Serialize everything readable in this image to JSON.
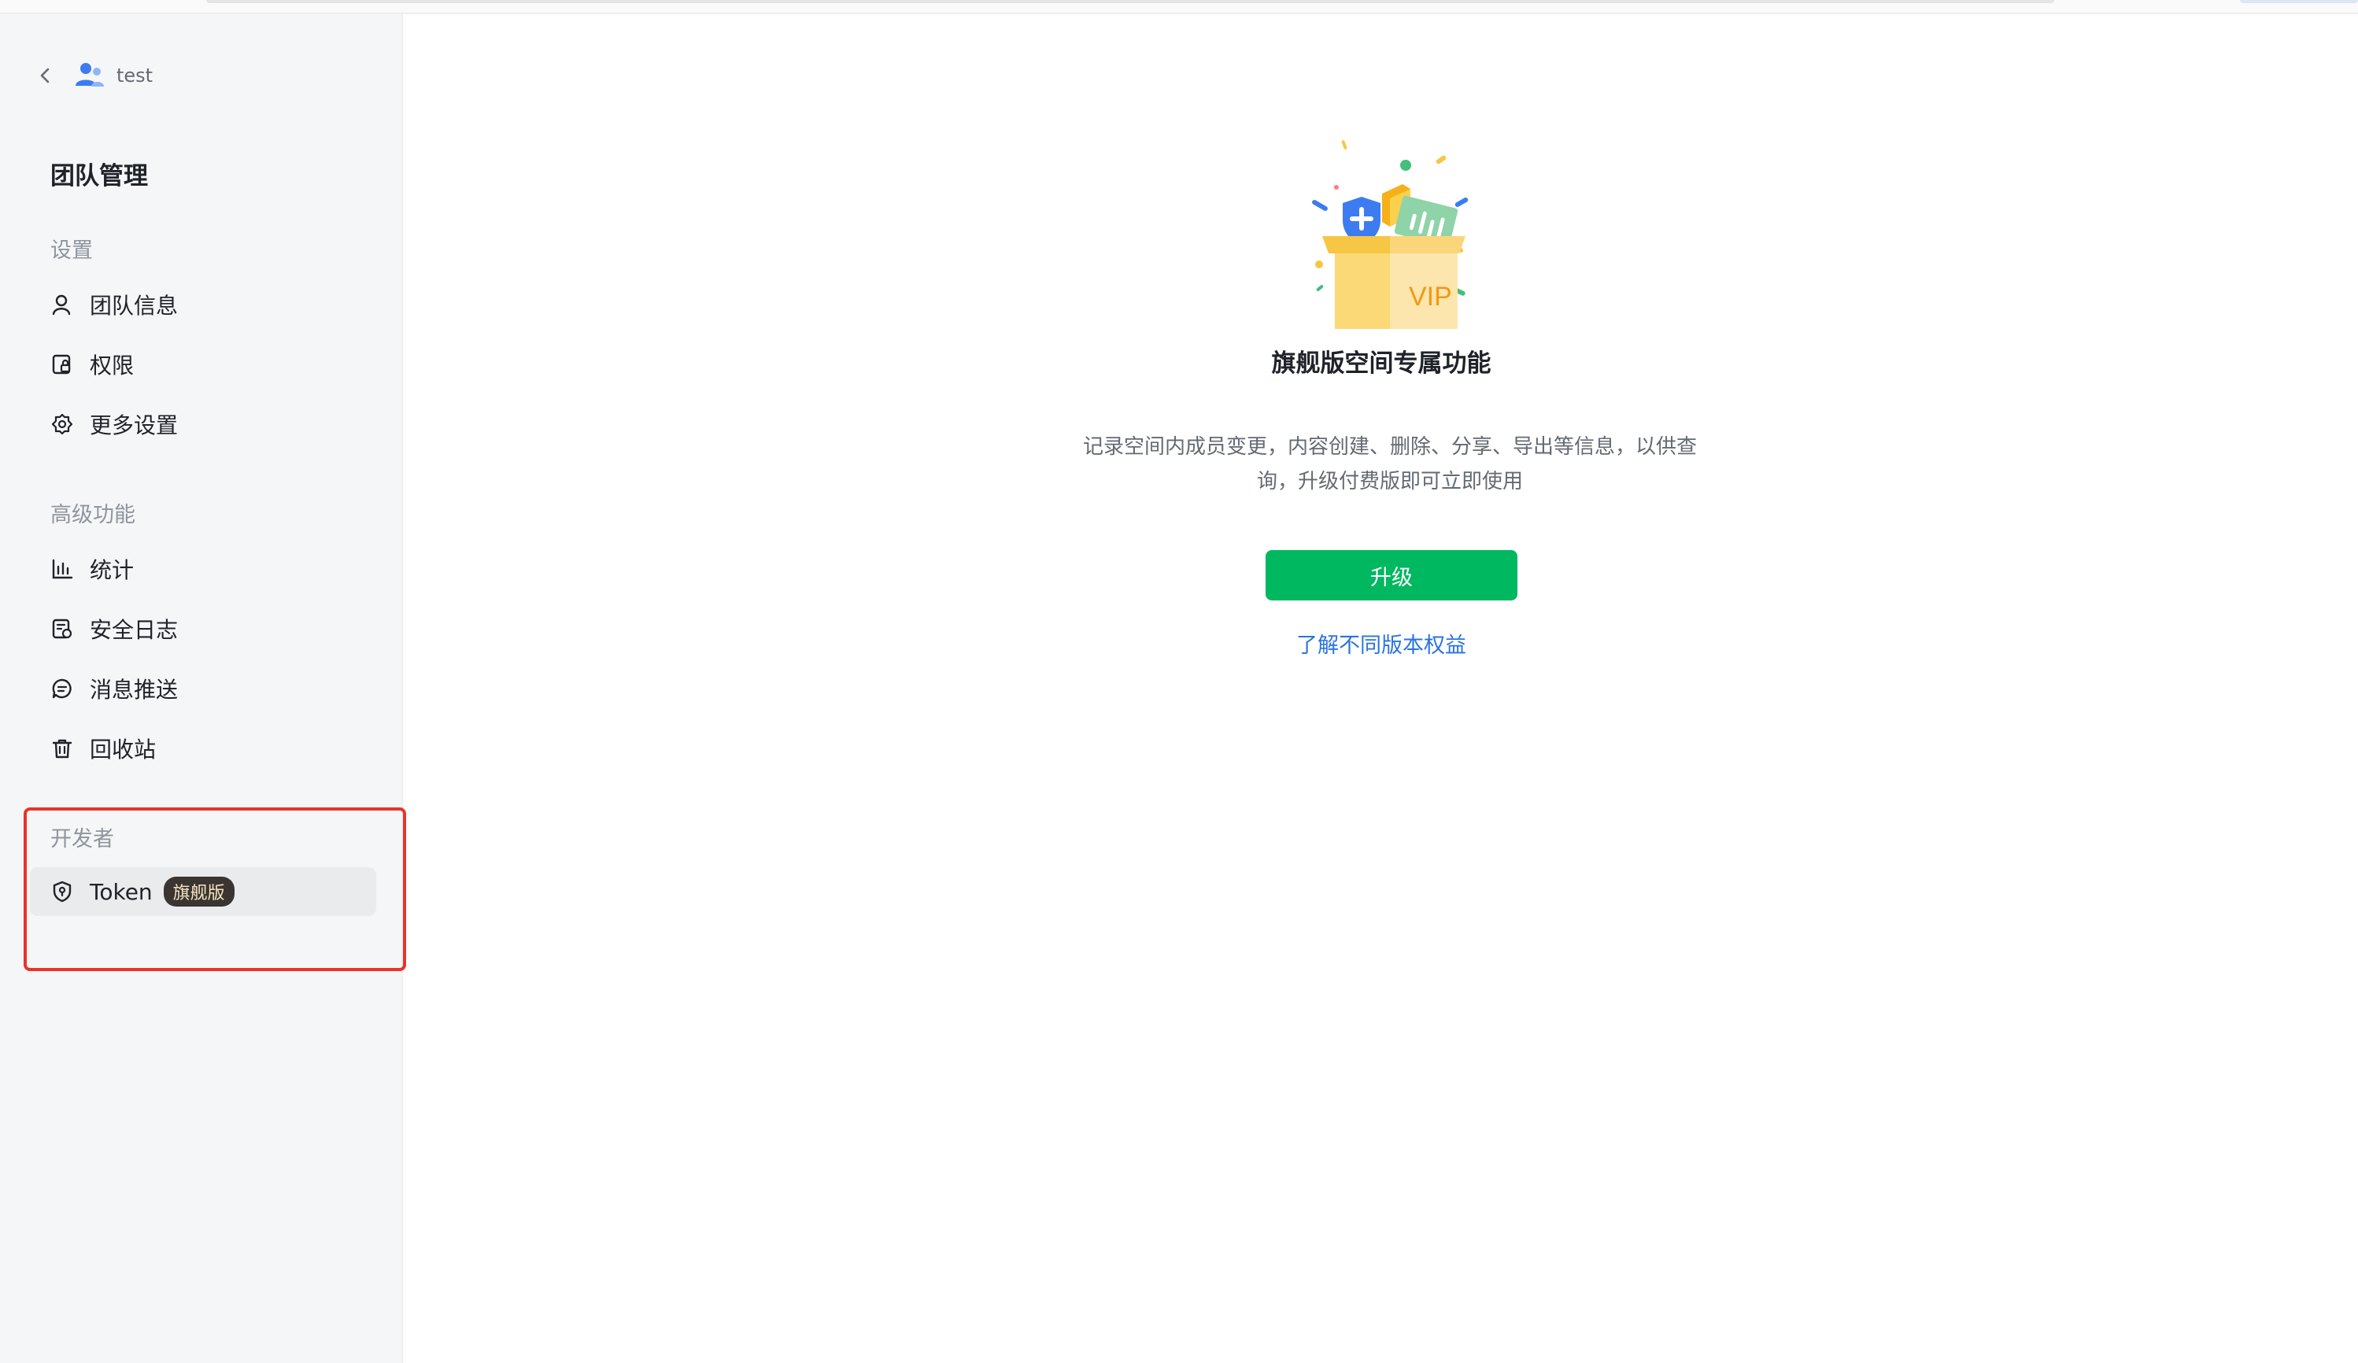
{
  "header": {
    "team_name": "test"
  },
  "sidebar": {
    "title": "团队管理",
    "sections": [
      {
        "label": "设置",
        "items": [
          {
            "label": "团队信息",
            "icon": "user-icon"
          },
          {
            "label": "权限",
            "icon": "permission-icon"
          },
          {
            "label": "更多设置",
            "icon": "gear-icon"
          }
        ]
      },
      {
        "label": "高级功能",
        "items": [
          {
            "label": "统计",
            "icon": "bar-chart-icon"
          },
          {
            "label": "安全日志",
            "icon": "log-icon"
          },
          {
            "label": "消息推送",
            "icon": "message-icon"
          },
          {
            "label": "回收站",
            "icon": "trash-icon"
          }
        ]
      },
      {
        "label": "开发者",
        "items": [
          {
            "label": "Token",
            "icon": "shield-icon",
            "badge": "旗舰版",
            "active": true
          }
        ]
      }
    ]
  },
  "main": {
    "illustration_text": "VIP",
    "title": "旗舰版空间专属功能",
    "description": "记录空间内成员变更，内容创建、删除、分享、导出等信息，以供查询，升级付费版即可立即使用",
    "upgrade_label": "升级",
    "learn_more_label": "了解不同版本权益"
  },
  "colors": {
    "primary_green": "#00b860",
    "link_blue": "#2a73e0",
    "highlight_red": "#e8332a",
    "sidebar_bg": "#f5f6f7"
  }
}
